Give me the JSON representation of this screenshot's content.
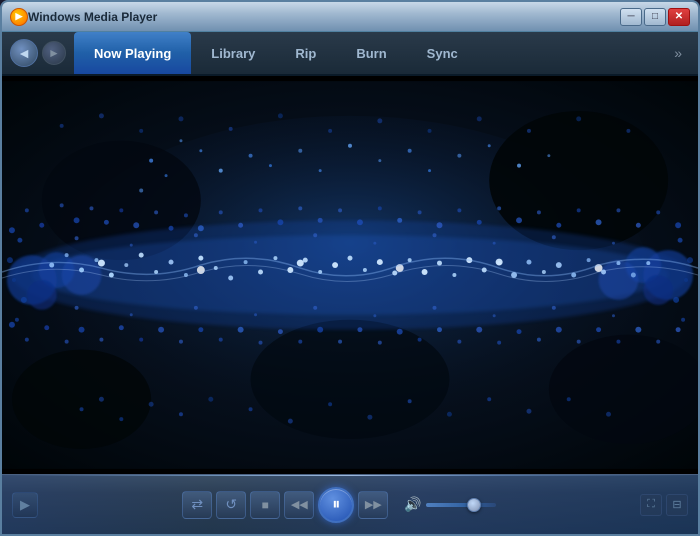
{
  "window": {
    "title": "Windows Media Player",
    "min_label": "─",
    "max_label": "□",
    "close_label": "✕"
  },
  "nav": {
    "back_icon": "◄",
    "forward_icon": "►",
    "more_icon": "»",
    "tabs": [
      {
        "id": "now-playing",
        "label": "Now Playing",
        "active": true
      },
      {
        "id": "library",
        "label": "Library",
        "active": false
      },
      {
        "id": "rip",
        "label": "Rip",
        "active": false
      },
      {
        "id": "burn",
        "label": "Burn",
        "active": false
      },
      {
        "id": "sync",
        "label": "Sync",
        "active": false
      }
    ]
  },
  "controls": {
    "shuffle_icon": "⇄",
    "repeat_icon": "↺",
    "stop_icon": "■",
    "prev_icon": "◀◀",
    "pause_icon": "⏸",
    "next_icon": "▶▶",
    "volume_icon": "♪",
    "fullscreen_icon": "⛶",
    "minimize_icon": "⊟"
  },
  "visualization": {
    "colors": {
      "primary": "#1a40a0",
      "secondary": "#0a2060",
      "accent": "#60a0ff",
      "highlight": "#c0e0ff",
      "dark": "#050d18"
    }
  }
}
